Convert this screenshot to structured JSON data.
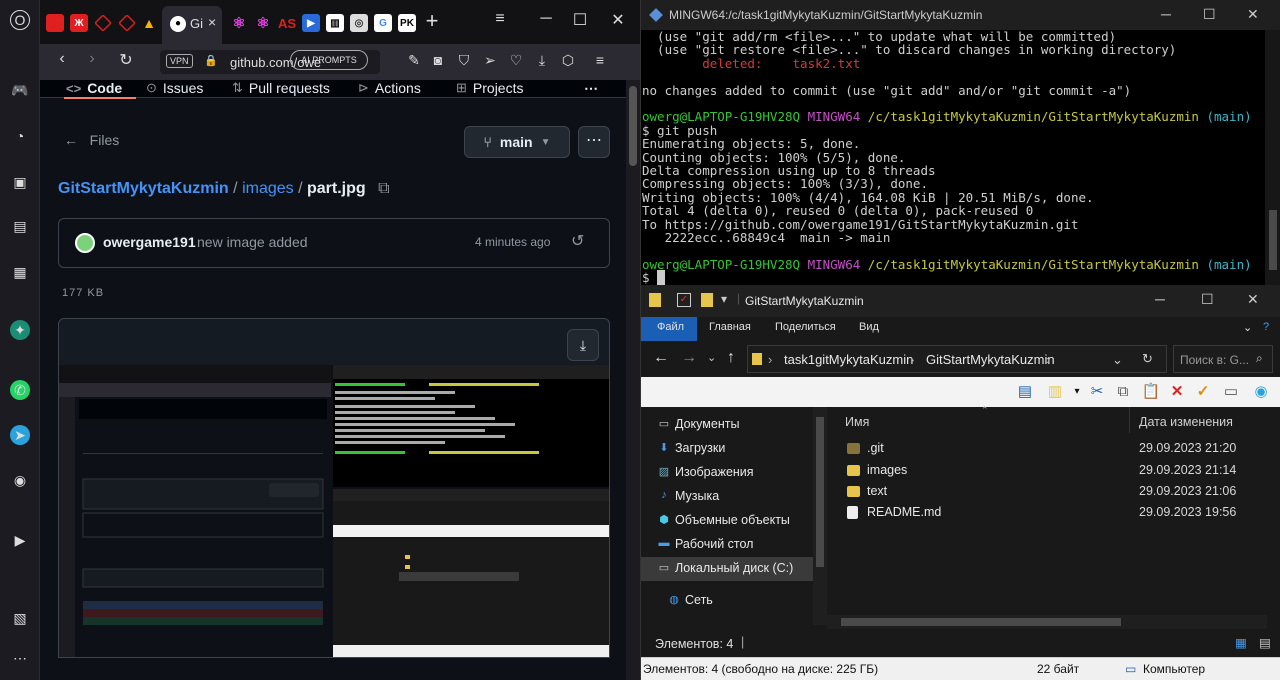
{
  "browser": {
    "tab_title": "Gi",
    "url": "github.com/owe",
    "vpn_label": "VPN",
    "ai_prompts_label": "AI PROMPTS",
    "tab_favicons": [
      "ubi",
      "zeta",
      "deco",
      "drive",
      "github",
      "ai1",
      "ai2",
      "AS",
      "film",
      "tv",
      "chrome",
      "google",
      "PK"
    ]
  },
  "github": {
    "nav": {
      "code": "Code",
      "issues": "Issues",
      "pull_requests": "Pull requests",
      "actions": "Actions",
      "projects": "Projects"
    },
    "files_label": "Files",
    "branch": "main",
    "breadcrumb": {
      "repo": "GitStartMykytaKuzmin",
      "sep1": "/",
      "folder": "images",
      "sep2": "/",
      "file": "part.jpg"
    },
    "commit": {
      "author": "owergame191",
      "message": "new image added",
      "time": "4 minutes ago"
    },
    "file_size": "177 KB"
  },
  "terminal": {
    "title": "MINGW64:/c/task1gitMykytaKuzmin/GitStartMykytaKuzmin",
    "lines": {
      "l1": "  (use \"git add/rm <file>...\" to update what will be committed)",
      "l2": "  (use \"git restore <file>...\" to discard changes in working directory)",
      "l3_label": "        deleted:    ",
      "l3_file": "task2.txt",
      "l4": "no changes added to commit (use \"git add\" and/or \"git commit -a\")",
      "prompt_user": "owerg@LAPTOP-G19HV28Q",
      "prompt_env": "MINGW64",
      "prompt_path": "/c/task1gitMykytaKuzmin/GitStartMykytaKuzmin",
      "prompt_branch": "(main)",
      "cmd": "$ git push",
      "o1": "Enumerating objects: 5, done.",
      "o2": "Counting objects: 100% (5/5), done.",
      "o3": "Delta compression using up to 8 threads",
      "o4": "Compressing objects: 100% (3/3), done.",
      "o5": "Writing objects: 100% (4/4), 164.08 KiB | 20.51 MiB/s, done.",
      "o6": "Total 4 (delta 0), reused 0 (delta 0), pack-reused 0",
      "o7": "To https://github.com/owergame191/GitStartMykytaKuzmin.git",
      "o8": "   2222ecc..68849c4  main -> main",
      "final_prompt": "$ "
    }
  },
  "explorer": {
    "title": "GitStartMykytaKuzmin",
    "menu": [
      "Файл",
      "Главная",
      "Поделиться",
      "Вид"
    ],
    "path": [
      "task1gitMykytaKuzmin",
      "GitStartMykytaKuzmin"
    ],
    "search_placeholder": "Поиск в: G...",
    "nav_items": [
      "Документы",
      "Загрузки",
      "Изображения",
      "Музыка",
      "Объемные объекты",
      "Рабочий стол",
      "Локальный диск (C:)",
      "Сеть"
    ],
    "columns": {
      "name": "Имя",
      "date": "Дата изменения"
    },
    "files": [
      {
        "name": ".git",
        "date": "29.09.2023 21:20",
        "type": "folder-dim"
      },
      {
        "name": "images",
        "date": "29.09.2023 21:14",
        "type": "folder"
      },
      {
        "name": "text",
        "date": "29.09.2023 21:06",
        "type": "folder"
      },
      {
        "name": "README.md",
        "date": "29.09.2023 19:56",
        "type": "file"
      }
    ],
    "status_items": "Элементов: 4",
    "status_bar": {
      "left": "Элементов: 4 (свободно на диске: 225 ГБ)",
      "size": "22 байт",
      "computer": "Компьютер"
    }
  }
}
